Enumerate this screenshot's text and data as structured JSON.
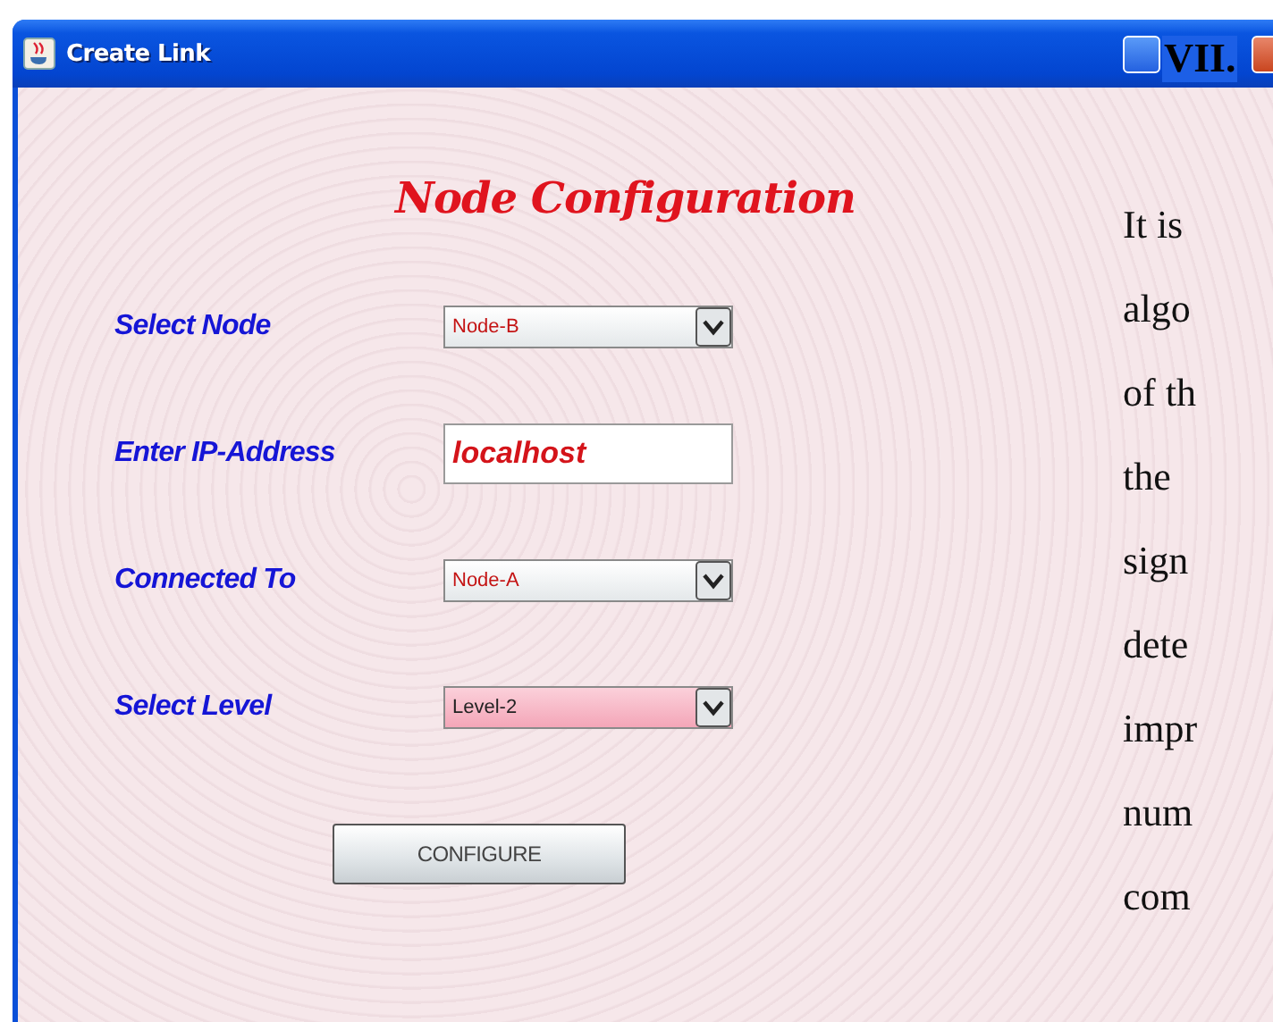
{
  "window": {
    "title": "Create Link"
  },
  "form": {
    "heading": "Node Configuration",
    "fields": [
      {
        "label": "Select Node",
        "kind": "combo",
        "value": "Node-B",
        "focused": false
      },
      {
        "label": "Enter IP-Address",
        "kind": "text",
        "value": "localhost",
        "focused": false
      },
      {
        "label": "Connected To",
        "kind": "combo",
        "value": "Node-A",
        "focused": false
      },
      {
        "label": "Select Level",
        "kind": "combo",
        "value": "Level-2",
        "focused": true
      }
    ],
    "button": "CONFIGURE"
  },
  "document": {
    "heading": "VII.",
    "lines": [
      "It is",
      "algo",
      "of th",
      "the",
      "sign",
      "dete",
      "impr",
      "num",
      "com"
    ]
  }
}
